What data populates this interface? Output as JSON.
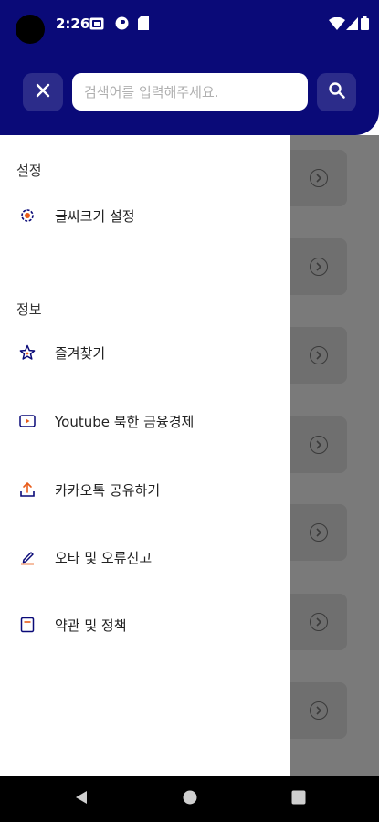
{
  "status_bar": {
    "time": "2:26"
  },
  "search": {
    "placeholder": "검색어를 입력해주세요."
  },
  "drawer": {
    "settings_section": {
      "title": "설정",
      "items": [
        {
          "label": "글씨크기 설정",
          "icon": "gear-icon"
        }
      ]
    },
    "info_section": {
      "title": "정보",
      "items": [
        {
          "label": "즐겨찾기",
          "icon": "star-icon"
        },
        {
          "label": "Youtube 북한 금융경제",
          "icon": "youtube-icon"
        },
        {
          "label": "카카오톡 공유하기",
          "icon": "share-icon"
        },
        {
          "label": "오타 및 오류신고",
          "icon": "edit-icon"
        },
        {
          "label": "약관 및 정책",
          "icon": "document-icon"
        }
      ]
    }
  },
  "colors": {
    "header": "#0a0a78",
    "button": "#2c2c8a",
    "accent_orange": "#e85c1a"
  }
}
